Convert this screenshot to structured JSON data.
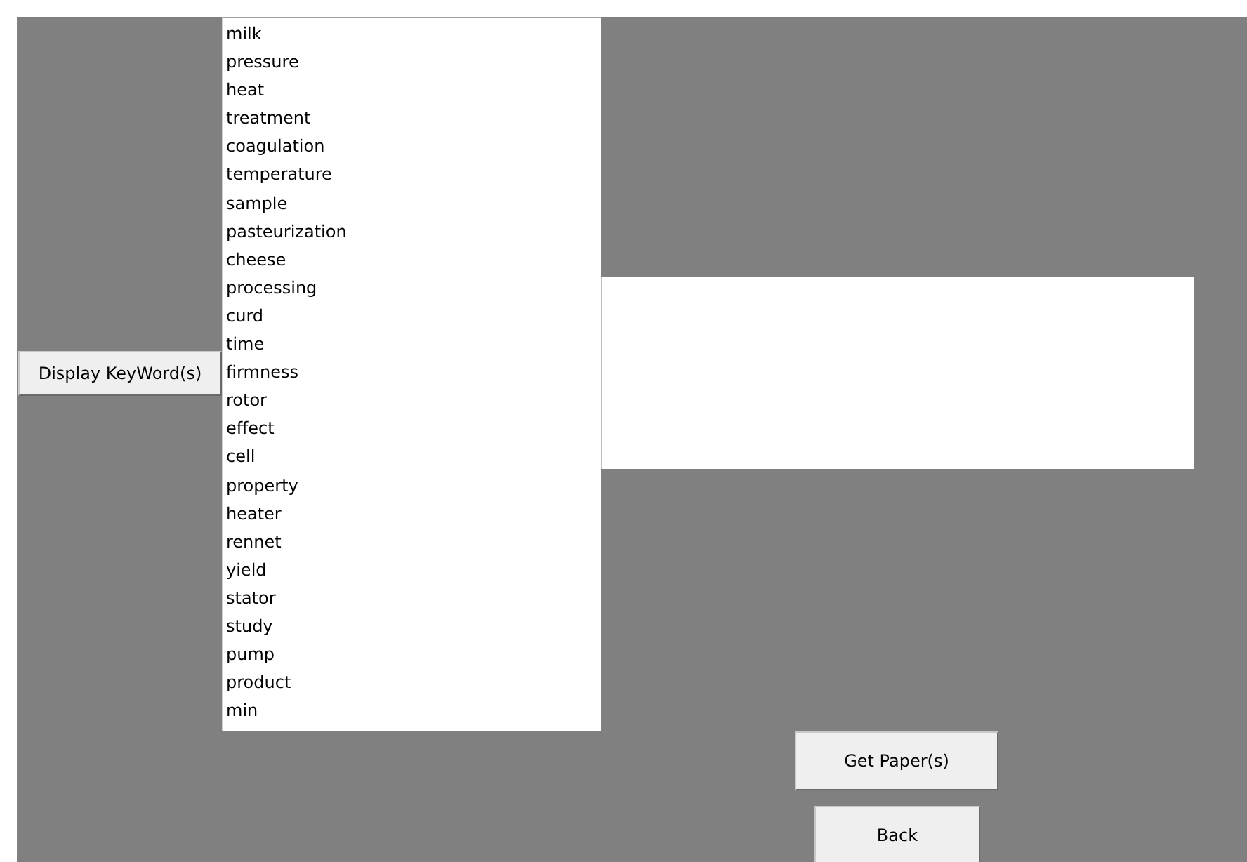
{
  "display_button": {
    "label": "Display KeyWord(s)"
  },
  "keywords": [
    "milk",
    "pressure",
    "heat",
    "treatment",
    "coagulation",
    "temperature",
    "sample",
    "pasteurization",
    "cheese",
    "processing",
    "curd",
    "time",
    "firmness",
    "rotor",
    "effect",
    "cell",
    "property",
    "heater",
    "rennet",
    "yield",
    "stator",
    "study",
    "pump",
    "product",
    "min"
  ],
  "get_papers_button": {
    "label": "Get Paper(s)"
  },
  "back_button": {
    "label": "Back"
  }
}
